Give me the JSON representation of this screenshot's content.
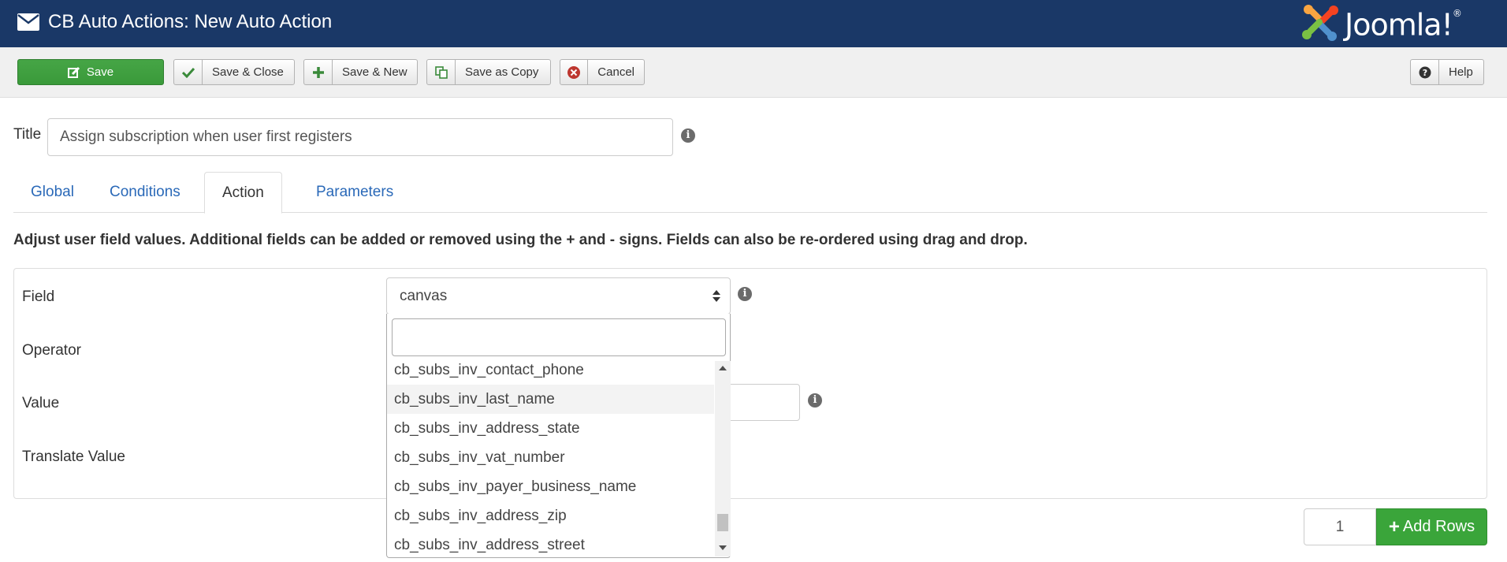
{
  "header": {
    "title": "CB Auto Actions: New Auto Action",
    "brand": "Joomla!",
    "brand_registered": "®"
  },
  "toolbar": {
    "save_label": "Save",
    "save_close_label": "Save & Close",
    "save_new_label": "Save & New",
    "save_copy_label": "Save as Copy",
    "cancel_label": "Cancel",
    "help_label": "Help"
  },
  "form": {
    "title_label": "Title",
    "title_value": "Assign subscription when user first registers"
  },
  "tabs": [
    {
      "label": "Global"
    },
    {
      "label": "Conditions"
    },
    {
      "label": "Action"
    },
    {
      "label": "Parameters"
    }
  ],
  "active_tab": "Action",
  "description": "Adjust user field values. Additional fields can be added or removed using the + and - signs. Fields can also be re-ordered using drag and drop.",
  "fields": {
    "field_label": "Field",
    "operator_label": "Operator",
    "value_label": "Value",
    "translate_label": "Translate Value",
    "field_selected": "canvas"
  },
  "dropdown": {
    "search_value": "",
    "options": [
      "cb_subs_inv_contact_phone",
      "cb_subs_inv_last_name",
      "cb_subs_inv_address_state",
      "cb_subs_inv_vat_number",
      "cb_subs_inv_payer_business_name",
      "cb_subs_inv_address_zip",
      "cb_subs_inv_address_street"
    ],
    "hovered_option": "cb_subs_inv_last_name"
  },
  "add_rows": {
    "count": "1",
    "button_label": "Add Rows"
  },
  "colors": {
    "header_bg": "#1a3867",
    "save_green": "#46a546",
    "link_blue": "#2a69b8",
    "add_rows_green": "#3aa53a"
  },
  "icons": {
    "header": "envelope-icon",
    "save": "edit-icon",
    "save_close": "check-icon",
    "save_new": "plus-icon",
    "save_copy": "copy-icon",
    "cancel": "cancel-circle-icon",
    "help": "question-circle-icon",
    "info": "info-circle-icon"
  }
}
